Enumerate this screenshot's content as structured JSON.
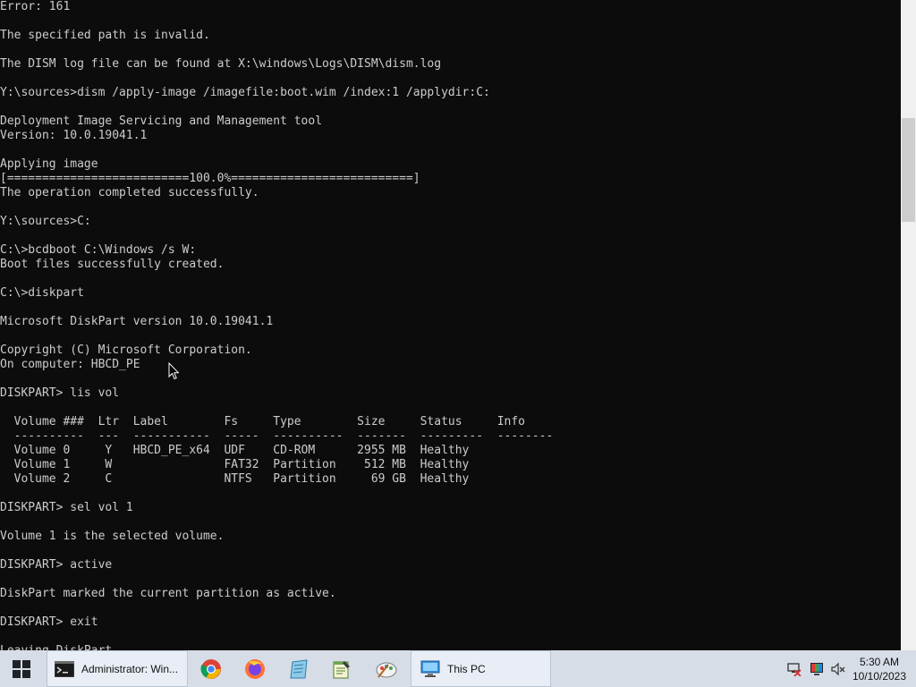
{
  "console": {
    "lines": [
      "Error: 161",
      "",
      "The specified path is invalid.",
      "",
      "The DISM log file can be found at X:\\windows\\Logs\\DISM\\dism.log",
      "",
      "Y:\\sources>dism /apply-image /imagefile:boot.wim /index:1 /applydir:C:",
      "",
      "Deployment Image Servicing and Management tool",
      "Version: 10.0.19041.1",
      "",
      "Applying image",
      "[==========================100.0%==========================]",
      "The operation completed successfully.",
      "",
      "Y:\\sources>C:",
      "",
      "C:\\>bcdboot C:\\Windows /s W:",
      "Boot files successfully created.",
      "",
      "C:\\>diskpart",
      "",
      "Microsoft DiskPart version 10.0.19041.1",
      "",
      "Copyright (C) Microsoft Corporation.",
      "On computer: HBCD_PE",
      "",
      "DISKPART> lis vol",
      "",
      "  Volume ###  Ltr  Label        Fs     Type        Size     Status     Info",
      "  ----------  ---  -----------  -----  ----------  -------  ---------  --------",
      "  Volume 0     Y   HBCD_PE_x64  UDF    CD-ROM      2955 MB  Healthy",
      "  Volume 1     W                FAT32  Partition    512 MB  Healthy",
      "  Volume 2     C                NTFS   Partition     69 GB  Healthy",
      "",
      "DISKPART> sel vol 1",
      "",
      "Volume 1 is the selected volume.",
      "",
      "DISKPART> active",
      "",
      "DiskPart marked the current partition as active.",
      "",
      "DISKPART> exit",
      "",
      "Leaving DiskPart..."
    ]
  },
  "taskbar": {
    "start_icon": "windows-logo-icon",
    "cmd_label": "Administrator: Win...",
    "chrome_icon": "chrome-icon",
    "firefox_icon": "firefox-icon",
    "notepad_icon": "notepad-icon",
    "editor_icon": "text-editor-icon",
    "paint_icon": "paint-icon",
    "thispc_label": "This PC",
    "tray": {
      "network_icon": "network-disconnected-icon",
      "display_icon": "display-color-icon",
      "volume_icon": "volume-muted-icon",
      "time": "5:30 AM",
      "date": "10/10/2023"
    }
  },
  "colors": {
    "console_bg": "#0c0c0c",
    "console_text": "#cccccc",
    "taskbar_bg": "#d7dde7"
  }
}
